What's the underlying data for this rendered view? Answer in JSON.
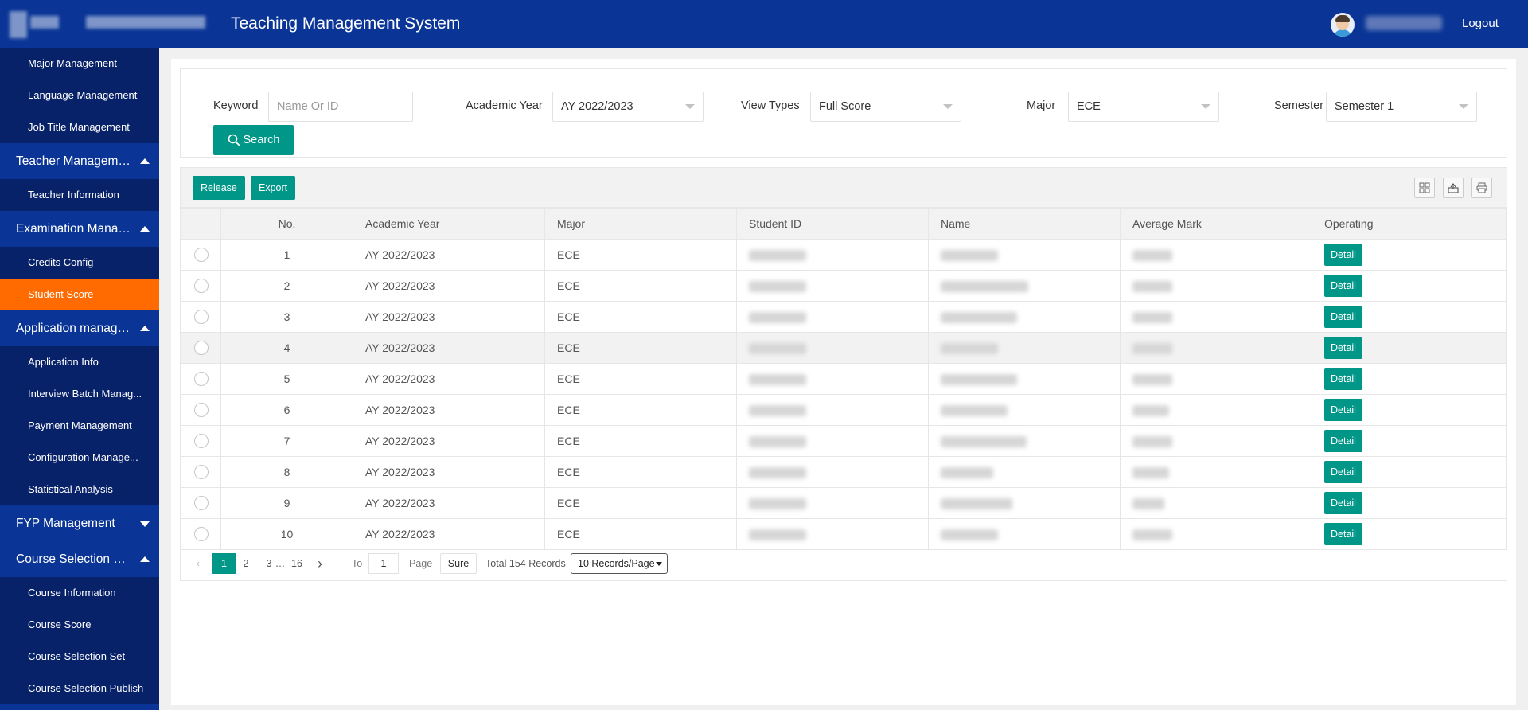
{
  "header": {
    "title": "Teaching Management System",
    "logout_label": "Logout"
  },
  "sidebar": {
    "items": [
      {
        "type": "sub",
        "label": "Major Management"
      },
      {
        "type": "sub",
        "label": "Language Management"
      },
      {
        "type": "sub",
        "label": "Job Title Management"
      },
      {
        "type": "group",
        "label": "Teacher Management",
        "expanded": true
      },
      {
        "type": "sub",
        "label": "Teacher Information"
      },
      {
        "type": "group",
        "label": "Examination Manage...",
        "expanded": true
      },
      {
        "type": "sub",
        "label": "Credits Config"
      },
      {
        "type": "sub",
        "label": "Student Score",
        "active": true
      },
      {
        "type": "group",
        "label": "Application managem...",
        "expanded": true
      },
      {
        "type": "sub",
        "label": "Application Info"
      },
      {
        "type": "sub",
        "label": "Interview Batch Manag..."
      },
      {
        "type": "sub",
        "label": "Payment Management"
      },
      {
        "type": "sub",
        "label": "Configuration Manage..."
      },
      {
        "type": "sub",
        "label": "Statistical Analysis"
      },
      {
        "type": "group",
        "label": "FYP Management",
        "expanded": false
      },
      {
        "type": "group",
        "label": "Course Selection Man...",
        "expanded": true
      },
      {
        "type": "sub",
        "label": "Course Information"
      },
      {
        "type": "sub",
        "label": "Course Score"
      },
      {
        "type": "sub",
        "label": "Course Selection Set"
      },
      {
        "type": "sub",
        "label": "Course Selection Publish"
      }
    ]
  },
  "filters": {
    "keyword_label": "Keyword",
    "keyword_placeholder": "Name Or ID",
    "keyword_value": "",
    "academic_year_label": "Academic Year",
    "academic_year_value": "AY 2022/2023",
    "view_types_label": "View Types",
    "view_types_value": "Full Score",
    "major_label": "Major",
    "major_value": "ECE",
    "semester_label": "Semester",
    "semester_value": "Semester 1",
    "search_label": "Search"
  },
  "toolbar": {
    "release_label": "Release",
    "export_label": "Export",
    "icons": [
      "columns-icon",
      "export-icon",
      "print-icon"
    ]
  },
  "table": {
    "columns": [
      "No.",
      "Academic Year",
      "Major",
      "Student ID",
      "Name",
      "Average Mark",
      "Operating"
    ],
    "detail_label": "Detail",
    "rows": [
      {
        "no": "1",
        "year": "AY 2022/2023",
        "major": "ECE"
      },
      {
        "no": "2",
        "year": "AY 2022/2023",
        "major": "ECE"
      },
      {
        "no": "3",
        "year": "AY 2022/2023",
        "major": "ECE"
      },
      {
        "no": "4",
        "year": "AY 2022/2023",
        "major": "ECE"
      },
      {
        "no": "5",
        "year": "AY 2022/2023",
        "major": "ECE"
      },
      {
        "no": "6",
        "year": "AY 2022/2023",
        "major": "ECE"
      },
      {
        "no": "7",
        "year": "AY 2022/2023",
        "major": "ECE"
      },
      {
        "no": "8",
        "year": "AY 2022/2023",
        "major": "ECE"
      },
      {
        "no": "9",
        "year": "AY 2022/2023",
        "major": "ECE"
      },
      {
        "no": "10",
        "year": "AY 2022/2023",
        "major": "ECE"
      }
    ]
  },
  "pagination": {
    "current_page": "1",
    "page_2": "2",
    "page_3": "3",
    "ellipsis": "…",
    "last_page": "16",
    "to_label": "To",
    "goto_value": "1",
    "page_label": "Page",
    "sure_label": "Sure",
    "total_label": "Total 154 Records",
    "page_size_value": "10 Records/Page"
  },
  "colors": {
    "header_bg": "#0a3596",
    "sidebar_sub_bg": "#08226a",
    "active_bg": "#ff6b00",
    "primary_btn": "#009688"
  }
}
